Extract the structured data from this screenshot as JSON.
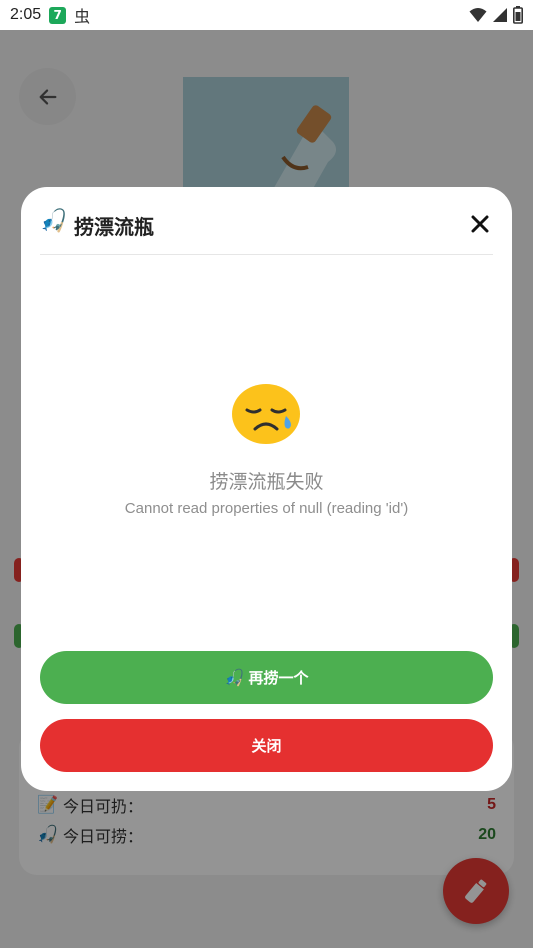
{
  "status_bar": {
    "time": "2:05",
    "app_badge": "7",
    "bug_glyph": "虫",
    "icons": [
      "wifi-icon",
      "signal-icon",
      "battery-icon"
    ]
  },
  "background": {
    "stats": [
      {
        "icon": "📝",
        "icon_name": "memo-icon",
        "label": "今日可扔：",
        "value": "5",
        "color": "#c62828"
      },
      {
        "icon": "🎣",
        "icon_name": "fishing-pole-icon",
        "label": "今日可捞：",
        "value": "20",
        "color": "#2e7d32"
      }
    ]
  },
  "dialog": {
    "title_icon": "🎣",
    "title": "捞漂流瓶",
    "error_icon": "sad-face-icon",
    "error_title": "捞漂流瓶失败",
    "error_message": "Cannot read properties of null (reading 'id')",
    "retry_icon": "🎣",
    "retry_label": "再捞一个",
    "close_label": "关闭"
  },
  "colors": {
    "accent_green": "#4caf50",
    "accent_red": "#e53030",
    "scrim": "rgba(0,0,0,0.42)"
  }
}
